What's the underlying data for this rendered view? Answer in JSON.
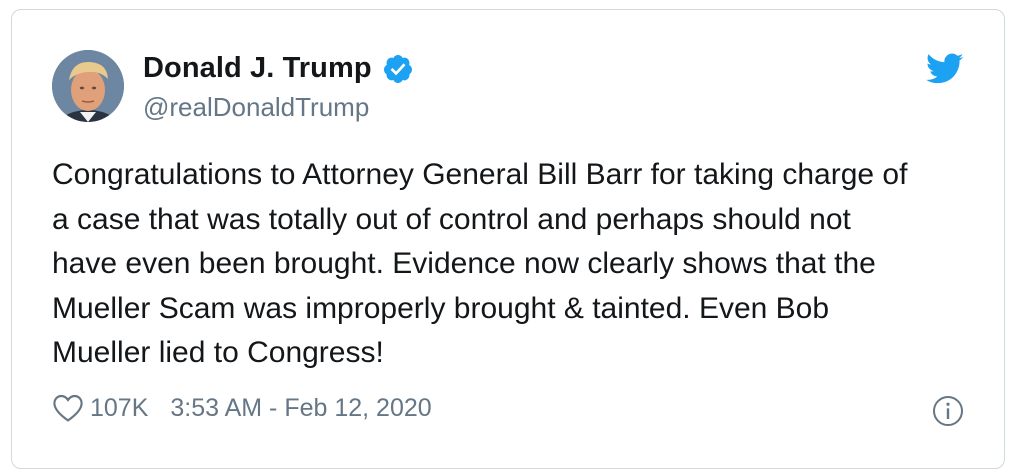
{
  "author": {
    "display_name": "Donald J. Trump",
    "handle": "@realDonaldTrump",
    "verified": true,
    "avatar_icon": "profile-photo"
  },
  "tweet": {
    "lines": [
      "Congratulations to Attorney General Bill Barr for taking charge of",
      "a case that was totally out of control and perhaps should not",
      "have even been brought. Evidence now clearly shows that the",
      "Mueller Scam was improperly brought & tainted. Even Bob",
      "Mueller lied to Congress!"
    ]
  },
  "footer": {
    "like_count": "107K",
    "timestamp": "3:53 AM - Feb 12, 2020"
  },
  "icons": {
    "brand": "twitter-bird-icon",
    "verified": "verified-badge-icon",
    "like": "heart-icon",
    "info": "info-icon"
  },
  "colors": {
    "brand_blue": "#1da1f2",
    "text_primary": "#14171a",
    "text_secondary": "#657786",
    "border": "#cfd9de"
  }
}
